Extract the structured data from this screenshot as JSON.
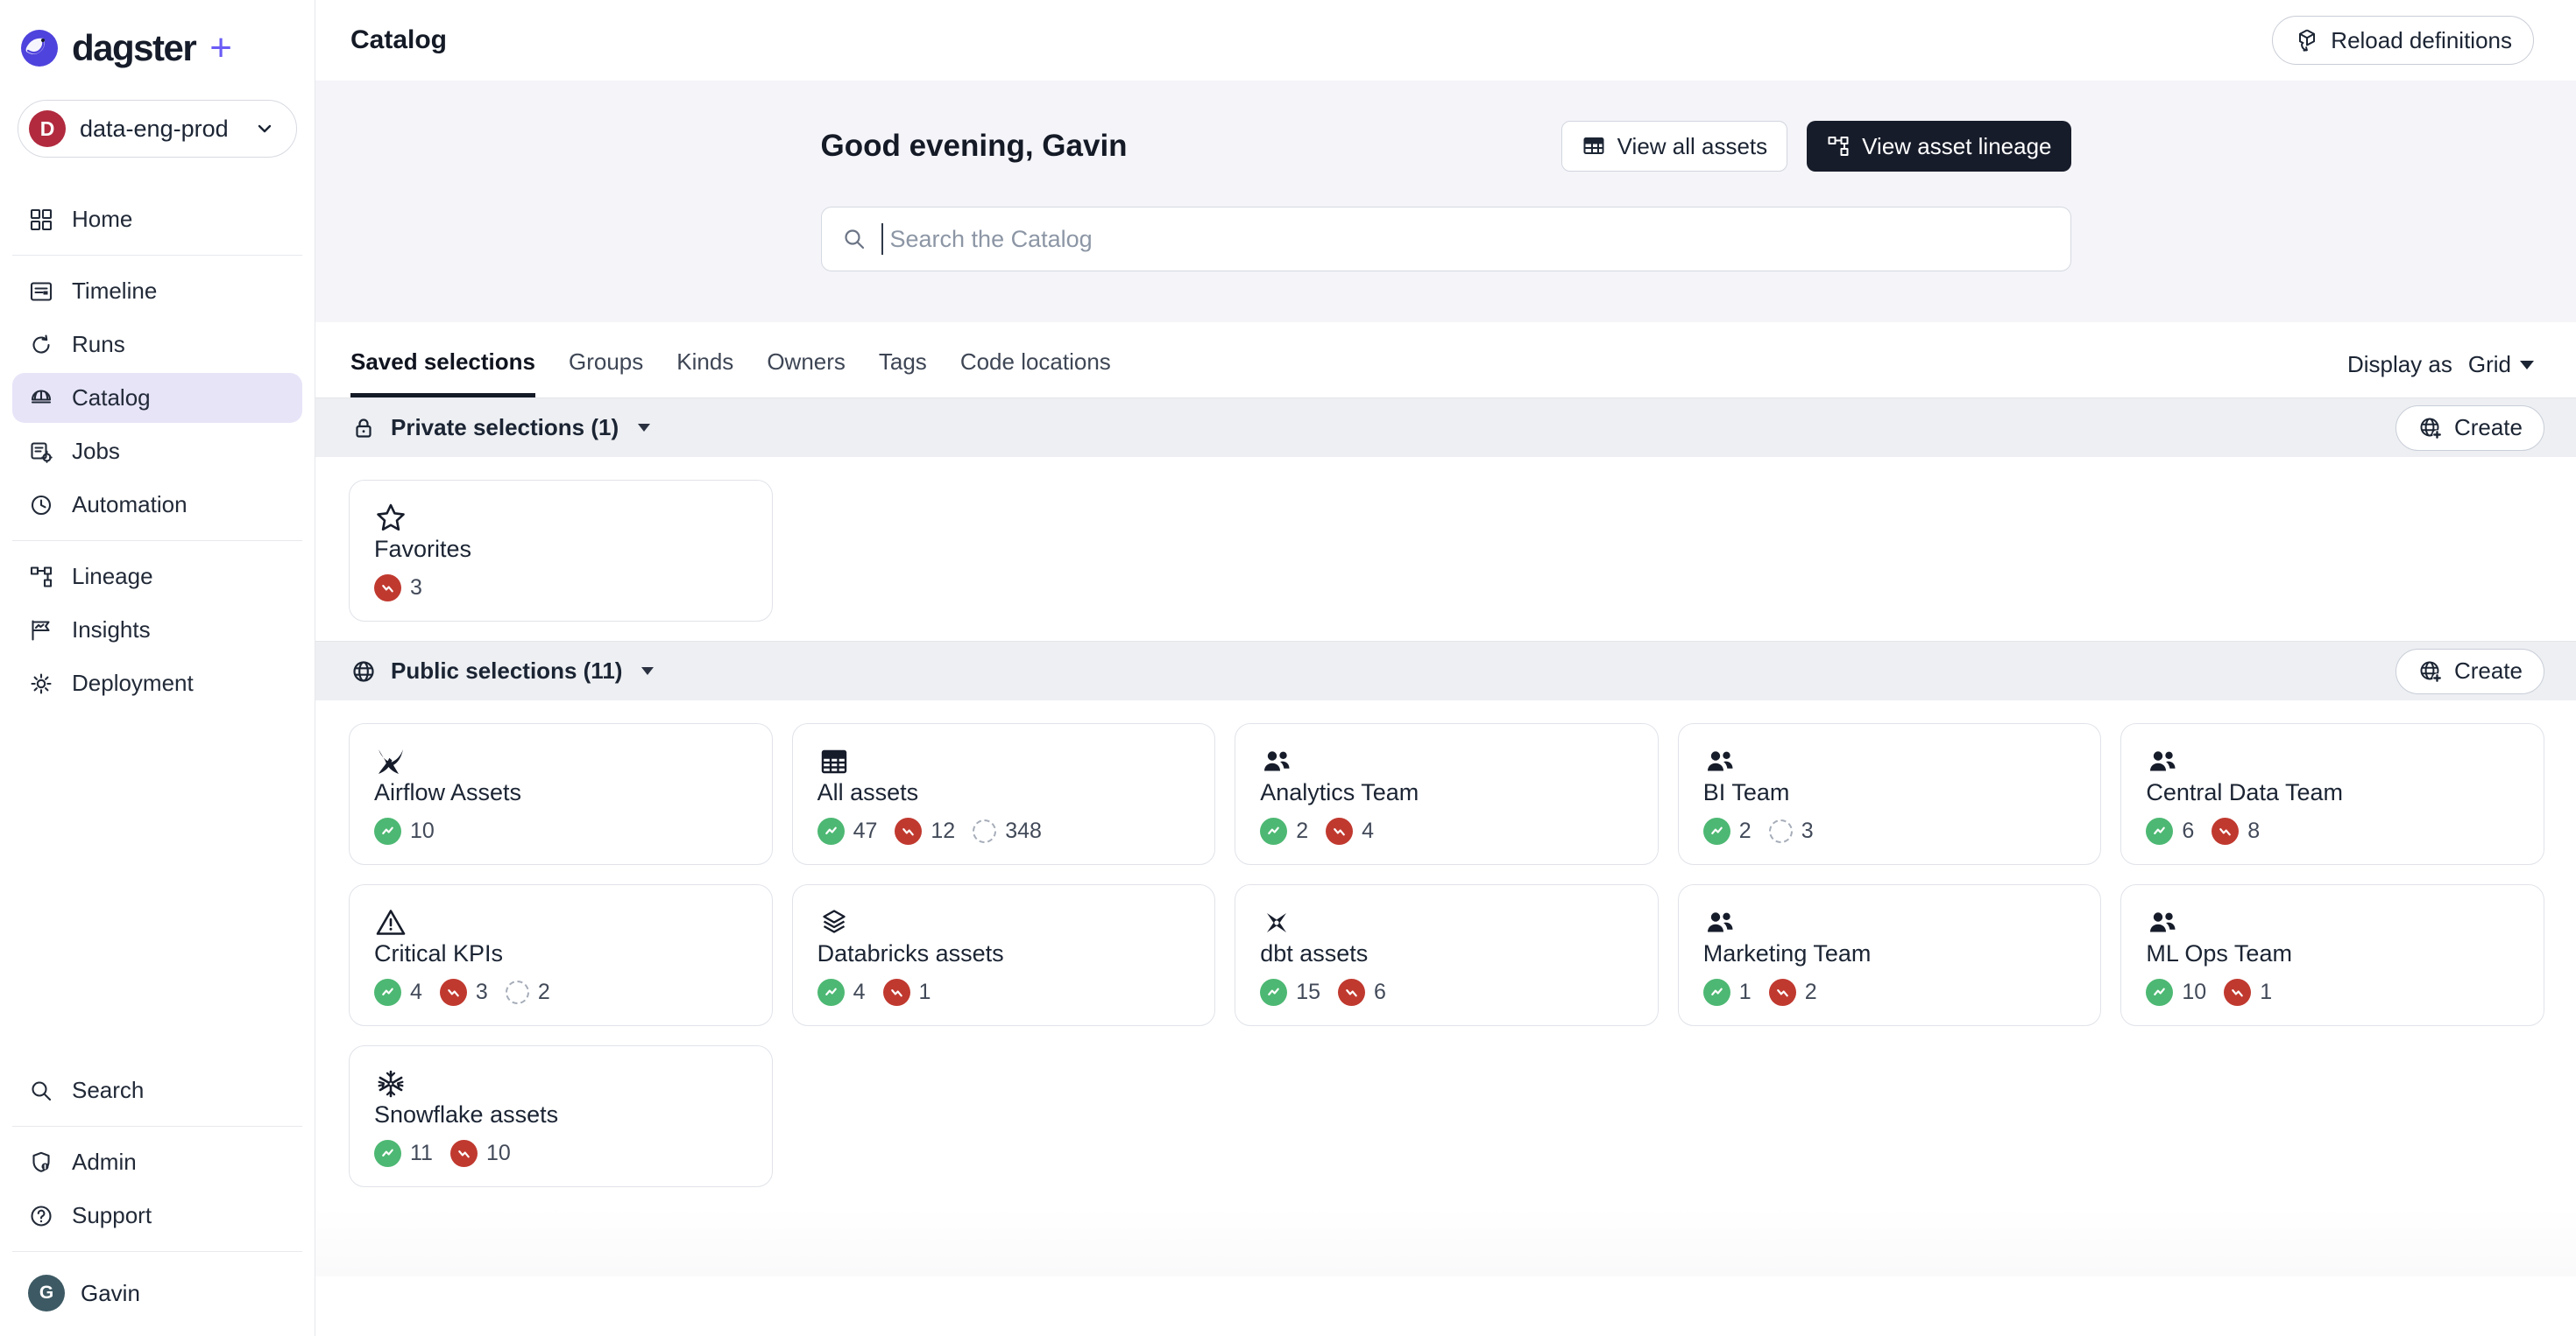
{
  "colors": {
    "accent_purple": "#5546E6",
    "nav_active_bg": "#E7E4F8",
    "status_success": "#4DB873",
    "status_failed": "#C0392F",
    "status_never_border": "#A6ADB9",
    "dark_button_bg": "#171C2A",
    "org_avatar_bg": "#B12A3E",
    "user_avatar_bg": "#3D5A64",
    "band_bg": "#EDEFF2",
    "hero_bg": "#F4F4F9"
  },
  "sidebar": {
    "logo": {
      "brand": "dagster",
      "plus": "+"
    },
    "org": {
      "initial": "D",
      "name": "data-eng-prod"
    },
    "nav": [
      {
        "label": "Home",
        "icon": "home-icon",
        "active": false,
        "divider_after": true
      },
      {
        "label": "Timeline",
        "icon": "timeline-icon",
        "active": false,
        "divider_after": false
      },
      {
        "label": "Runs",
        "icon": "runs-icon",
        "active": false,
        "divider_after": false
      },
      {
        "label": "Catalog",
        "icon": "catalog-icon",
        "active": true,
        "divider_after": false
      },
      {
        "label": "Jobs",
        "icon": "jobs-icon",
        "active": false,
        "divider_after": false
      },
      {
        "label": "Automation",
        "icon": "automation-icon",
        "active": false,
        "divider_after": true
      },
      {
        "label": "Lineage",
        "icon": "lineage-icon",
        "active": false,
        "divider_after": false
      },
      {
        "label": "Insights",
        "icon": "insights-icon",
        "active": false,
        "divider_after": false
      },
      {
        "label": "Deployment",
        "icon": "deployment-icon",
        "active": false,
        "divider_after": false
      }
    ],
    "footer": [
      {
        "label": "Search",
        "icon": "search-icon",
        "divider_after": true
      },
      {
        "label": "Admin",
        "icon": "admin-icon",
        "divider_after": false
      },
      {
        "label": "Support",
        "icon": "support-icon",
        "divider_after": true
      }
    ],
    "user": {
      "initial": "G",
      "name": "Gavin"
    }
  },
  "header": {
    "title": "Catalog",
    "reload_label": "Reload definitions"
  },
  "hero": {
    "greeting": "Good evening, Gavin",
    "btn_all_assets": "View all assets",
    "btn_lineage": "View asset lineage",
    "search_placeholder": "Search the Catalog"
  },
  "tabs": [
    {
      "label": "Saved selections",
      "active": true
    },
    {
      "label": "Groups",
      "active": false
    },
    {
      "label": "Kinds",
      "active": false
    },
    {
      "label": "Owners",
      "active": false
    },
    {
      "label": "Tags",
      "active": false
    },
    {
      "label": "Code locations",
      "active": false
    }
  ],
  "display": {
    "label": "Display as",
    "value": "Grid"
  },
  "sections": [
    {
      "title": "Private selections (1)",
      "icon": "lock-icon",
      "create_label": "Create",
      "cards": [
        {
          "title": "Favorites",
          "icon": "star-icon",
          "counts": [
            {
              "type": "failed",
              "value": "3"
            }
          ]
        }
      ]
    },
    {
      "title": "Public selections (11)",
      "icon": "globe-icon",
      "create_label": "Create",
      "cards": [
        {
          "title": "Airflow Assets",
          "icon": "airflow-icon",
          "counts": [
            {
              "type": "success",
              "value": "10"
            }
          ]
        },
        {
          "title": "All assets",
          "icon": "table-icon",
          "counts": [
            {
              "type": "success",
              "value": "47"
            },
            {
              "type": "failed",
              "value": "12"
            },
            {
              "type": "never",
              "value": "348"
            }
          ]
        },
        {
          "title": "Analytics Team",
          "icon": "people-icon",
          "counts": [
            {
              "type": "success",
              "value": "2"
            },
            {
              "type": "failed",
              "value": "4"
            }
          ]
        },
        {
          "title": "BI Team",
          "icon": "people-icon",
          "counts": [
            {
              "type": "success",
              "value": "2"
            },
            {
              "type": "never",
              "value": "3"
            }
          ]
        },
        {
          "title": "Central Data Team",
          "icon": "people-icon",
          "counts": [
            {
              "type": "success",
              "value": "6"
            },
            {
              "type": "failed",
              "value": "8"
            }
          ]
        },
        {
          "title": "Critical KPIs",
          "icon": "warning-icon",
          "counts": [
            {
              "type": "success",
              "value": "4"
            },
            {
              "type": "failed",
              "value": "3"
            },
            {
              "type": "never",
              "value": "2"
            }
          ]
        },
        {
          "title": "Databricks assets",
          "icon": "layers-icon",
          "counts": [
            {
              "type": "success",
              "value": "4"
            },
            {
              "type": "failed",
              "value": "1"
            }
          ]
        },
        {
          "title": "dbt assets",
          "icon": "dbt-icon",
          "counts": [
            {
              "type": "success",
              "value": "15"
            },
            {
              "type": "failed",
              "value": "6"
            }
          ]
        },
        {
          "title": "Marketing Team",
          "icon": "people-icon",
          "counts": [
            {
              "type": "success",
              "value": "1"
            },
            {
              "type": "failed",
              "value": "2"
            }
          ]
        },
        {
          "title": "ML Ops Team",
          "icon": "people-icon",
          "counts": [
            {
              "type": "success",
              "value": "10"
            },
            {
              "type": "failed",
              "value": "1"
            }
          ]
        },
        {
          "title": "Snowflake assets",
          "icon": "snowflake-icon",
          "counts": [
            {
              "type": "success",
              "value": "11"
            },
            {
              "type": "failed",
              "value": "10"
            }
          ]
        }
      ]
    }
  ]
}
